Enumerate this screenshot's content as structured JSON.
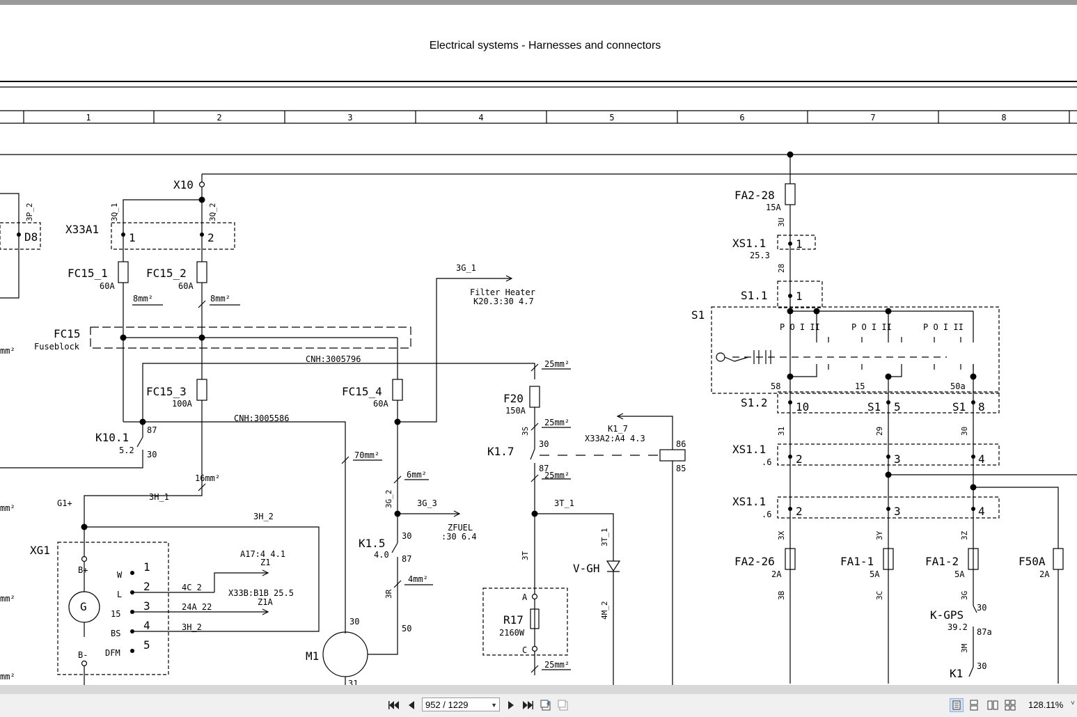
{
  "document": {
    "title": "Electrical systems - Harnesses and connectors",
    "columns": [
      "1",
      "2",
      "3",
      "4",
      "5",
      "6",
      "7",
      "8"
    ]
  },
  "labels": {
    "x10": "X10",
    "x33a1": "X33A1",
    "d8": "D8",
    "w3p2": "3P_2",
    "w3q1": "3Q_1",
    "w3q2": "3Q_2",
    "fc15_1": "FC15_1",
    "fc15_1_rating": "60A",
    "fc15_2": "FC15_2",
    "fc15_2_rating": "60A",
    "fc15": "FC15",
    "fuseblock": "Fuseblock",
    "fc15_3": "FC15_3",
    "fc15_3_rating": "100A",
    "fc15_4": "FC15_4",
    "fc15_4_rating": "60A",
    "mm8a": "8mm²",
    "mm8b": "8mm²",
    "mm_l1": "mm²",
    "mm_l2": "mm²",
    "mm_l3": "mm²",
    "mm_l4": "mm²",
    "cnh1": "CNH:3005796",
    "cnh2": "CNH:3005586",
    "w3g1": "3G_1",
    "filter1": "Filter Heater",
    "filter2": "K20.3:30 4.7",
    "k10": "K10.1",
    "k10_ref": "5.2",
    "k10_87": "87",
    "k10_30": "30",
    "mm16": "16mm²",
    "g1plus": "G1+",
    "w3h1": "3H_1",
    "w3h2": "3H_2",
    "xg1": "XG1",
    "bplus": "B+",
    "bminus": "B-",
    "pw": "W",
    "pl": "L",
    "p15": "15",
    "pbs": "BS",
    "pdfm": "DFM",
    "n1": "1",
    "n2": "2",
    "n3": "3",
    "n4": "4",
    "n5": "5",
    "g": "G",
    "a17": "A17:4 4.1",
    "z1": "Z1",
    "w4c2": "4C_2",
    "w24a22": "24A_22",
    "x33b": "X33B:B1B 25.5",
    "z1a": "Z1A",
    "w3h2b": "3H_2",
    "m1": "M1",
    "m1_30": "30",
    "m1_31": "31",
    "mm70": "70mm²",
    "mm6": "6mm²",
    "w3g2": "3G_2",
    "w3g3": "3G_3",
    "zfuel1": "ZFUEL",
    "zfuel2": ":30 6.4",
    "k15": "K1.5",
    "k15_ref": "4.0",
    "k15_30": "30",
    "k15_87": "87",
    "mm4": "4mm²",
    "w3r": "3R",
    "k15_50": "50",
    "mm25a": "25mm²",
    "f20": "F20",
    "f20_rating": "150A",
    "w3s": "3S",
    "mm25b": "25mm²",
    "k17": "K1.7",
    "k17_30": "30",
    "k17_87": "87",
    "mm25c": "25mm²",
    "k17ref1": "K1_7",
    "k17ref2": "X33A2:A4 4.3",
    "k17_86": "86",
    "k17_85": "85",
    "w3t1": "3T_1",
    "w3t": "3T",
    "w3t1b": "3T_1",
    "vgh": "V-GH",
    "w4m2": "4M_2",
    "ra": "A",
    "rc": "C",
    "r17": "R17",
    "r17_rating": "2160W",
    "mm25d": "25mm²",
    "fa228": "FA2-28",
    "fa228_rating": "15A",
    "w3u": "3U",
    "xs11a": "XS1.1",
    "xs11a_ref": "25.3",
    "w28": "28",
    "s11": "S1.1",
    "s1": "S1",
    "poii1": "P O I II",
    "poii2": "P O I II",
    "poii3": "P O I II",
    "t58": "58",
    "t15": "15",
    "t50a": "50a",
    "s12": "S1.2",
    "s1b": "S1",
    "s1c": "S1",
    "w31": "31",
    "w29": "29",
    "w30": "30",
    "xs11b": "XS1.1",
    "xs11b_ref": ".6",
    "xs11c": "XS1.1",
    "xs11c_ref": ".6",
    "w3x": "3X",
    "w3y": "3Y",
    "w3z": "3Z",
    "fa226": "FA2-26",
    "fa226_rating": "2A",
    "fa11": "FA1-1",
    "fa11_rating": "5A",
    "fa12": "FA1-2",
    "fa12_rating": "5A",
    "f50a": "F50A",
    "f50a_rating": "2A",
    "w3b": "3B",
    "w3c": "3C",
    "w3g": "3G",
    "kgps": "K-GPS",
    "kgps_ref": "39.2",
    "kgps_87a": "87a",
    "kgps_30": "30",
    "w3m": "3M",
    "k1": "K1",
    "k1_30": "30"
  },
  "viewer": {
    "page_value": "952 / 1229",
    "zoom": "128.11%"
  },
  "colors": {
    "line": "#000000",
    "page_bg": "#ffffff",
    "status_bg": "#f0f0f0"
  }
}
